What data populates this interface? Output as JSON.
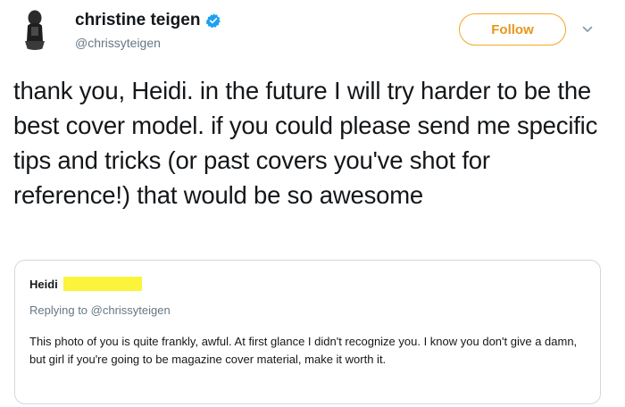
{
  "tweet": {
    "display_name": "christine teigen",
    "handle": "@chrissyteigen",
    "follow_label": "Follow",
    "text": "thank you, Heidi. in the future I will try harder to be the best cover model. if you could please send me specific tips and tricks (or past covers you've shot for reference!) that would be so awesome",
    "icons": {
      "verified": "verified-badge-icon",
      "caret": "chevron-down-icon"
    },
    "colors": {
      "follow_accent": "#f5a623",
      "verified": "#1da1f2",
      "redaction": "#fbf43a"
    }
  },
  "quoted_message": {
    "author": "Heidi",
    "replying_to": "Replying to @chrissyteigen",
    "text": "This photo of you is quite frankly, awful. At first glance I didn't recognize you. I know you don't give a damn, but girl if you're going to be magazine cover material, make it worth it."
  }
}
